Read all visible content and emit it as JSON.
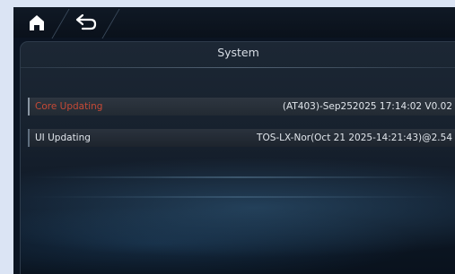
{
  "nav": {
    "home_icon": "home-icon",
    "back_icon": "back-arrow-icon"
  },
  "panel": {
    "title": "System",
    "items": [
      {
        "label": "Core Updating",
        "value": "(AT403)-Sep252025 17:14:02 V0.02",
        "selected": true
      },
      {
        "label": "UI Updating",
        "value": "TOS-LX-Nor(Oct 21 2025-14:21:43)@2.54",
        "selected": false
      }
    ]
  },
  "colors": {
    "selected_label": "#c64a36",
    "text": "#e1e6ec",
    "background": "#0b1422",
    "outer_frame": "#dbe4f4"
  }
}
